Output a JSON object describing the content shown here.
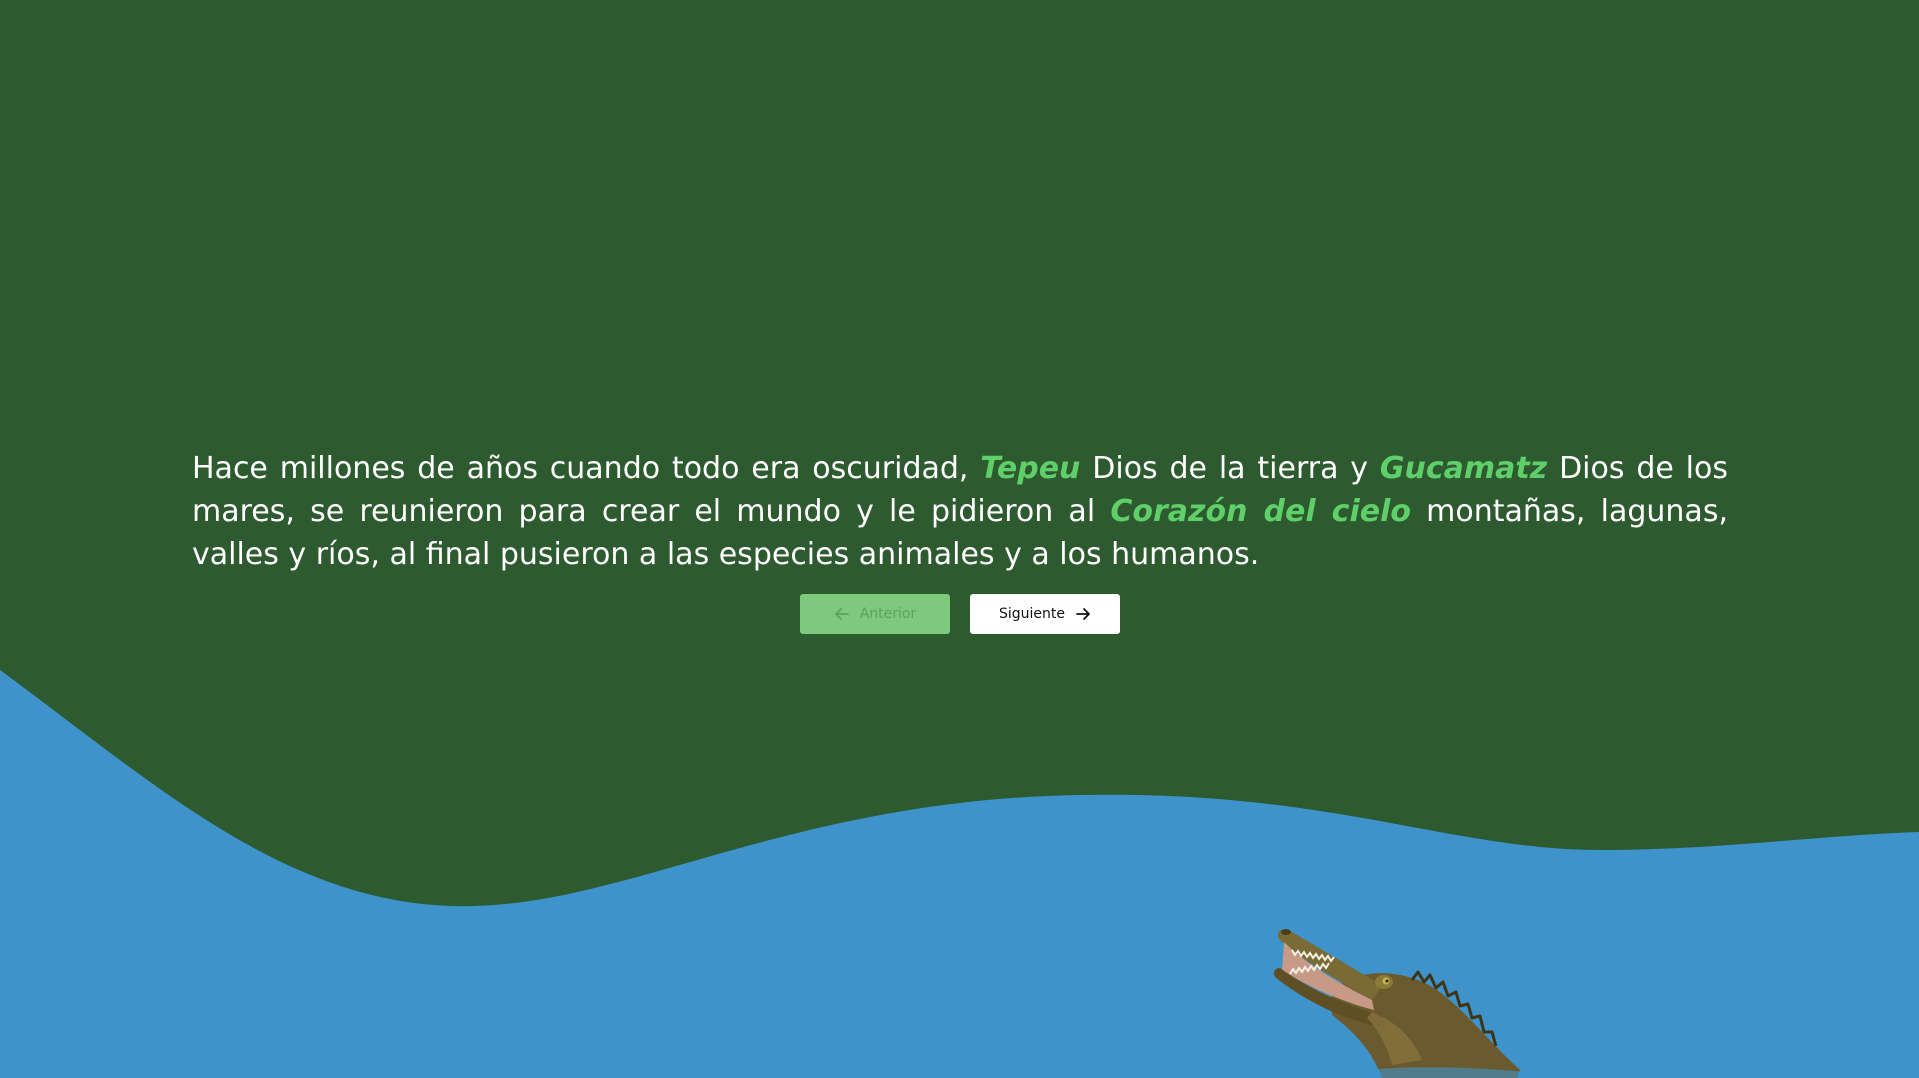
{
  "story": {
    "seg1": "Hace millones de años cuando todo era oscuridad, ",
    "god1": "Tepeu",
    "seg2": " Dios de la tierra y ",
    "god2": "Gucamatz",
    "seg3": " Dios de los mares, se reunieron para crear el mundo y le pidieron al ",
    "god3": "Corazón del cielo",
    "seg4": " montañas, lagunas, valles y ríos, al final pusieron a las especies animales y a los humanos."
  },
  "nav": {
    "prev_label": "Anterior",
    "next_label": "Siguiente",
    "prev_icon": "arrow-left-icon",
    "next_icon": "arrow-right-icon"
  },
  "colors": {
    "background": "#2d5a2f",
    "water": "#3e93cb",
    "highlight": "#5fcf6a",
    "prev_button": "#7dca7f",
    "next_button": "#ffffff"
  },
  "illustration": "crocodile"
}
